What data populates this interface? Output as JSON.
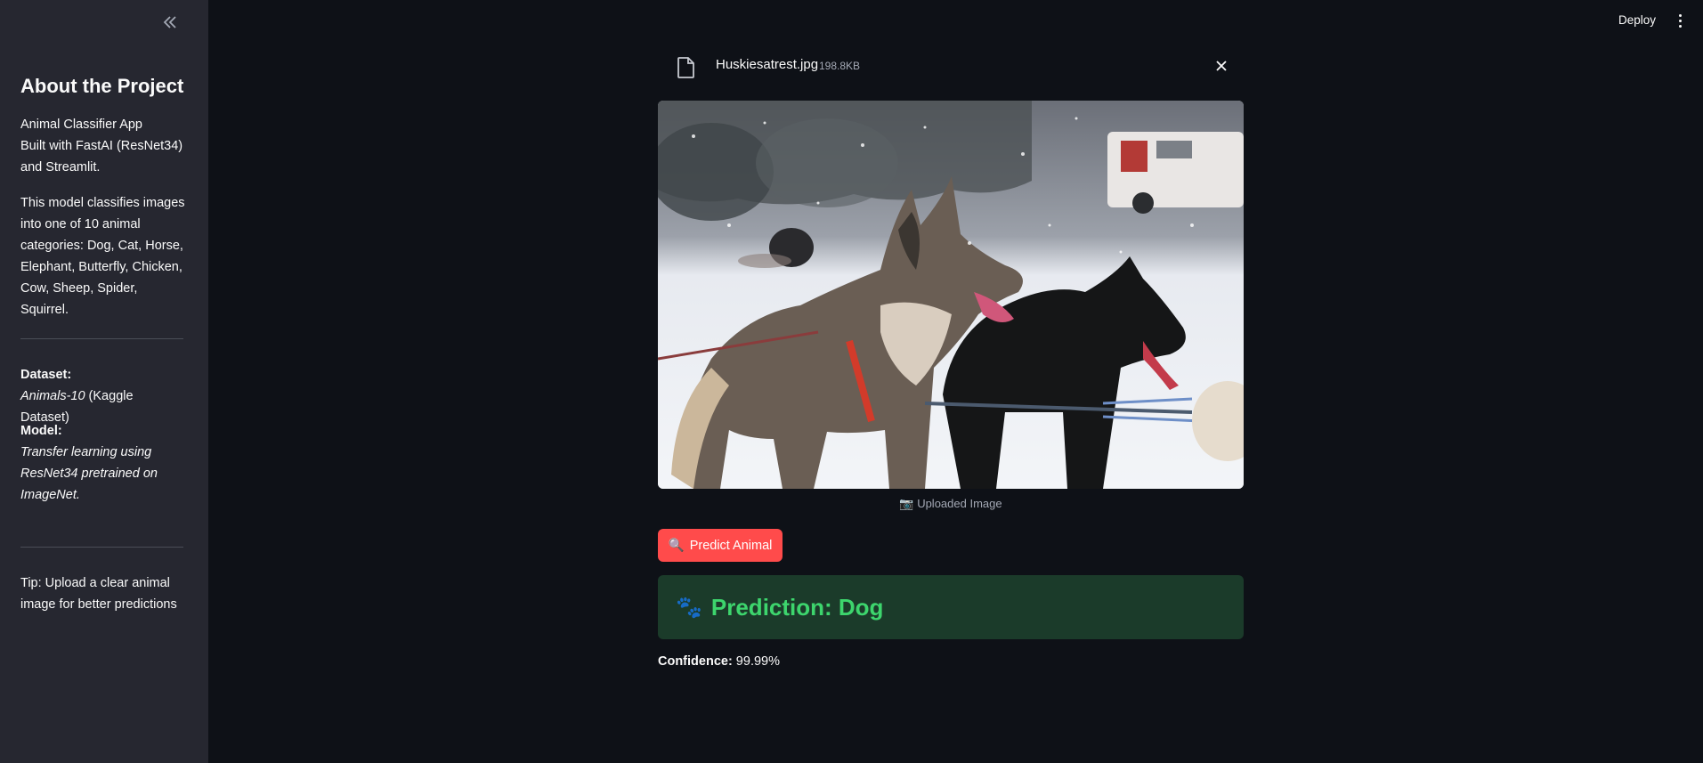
{
  "sidebar": {
    "collapse_icon": "double-chevron-left-icon",
    "title": "About the Project",
    "intro_line1": "Animal Classifier App",
    "intro_line2": "Built with FastAI (ResNet34)",
    "intro_line3": "and Streamlit.",
    "description": "This model classifies images into one of 10 animal categories: Dog, Cat, Horse, Elephant, Butterfly, Chicken, Cow, Sheep, Spider, Squirrel.",
    "dataset_label": "Dataset:",
    "dataset_name": "Animals-10",
    "dataset_source": " (Kaggle Dataset)",
    "model_label": "Model:",
    "model_desc": "Transfer learning using ResNet34 pretrained on ImageNet.",
    "tip": "Tip: Upload a clear animal image for better predictions"
  },
  "header": {
    "deploy_label": "Deploy",
    "menu_icon": "kebab-menu-icon"
  },
  "file": {
    "name": "Huskiesatrest.jpg",
    "size": "198.8KB",
    "icon": "file-icon",
    "close_icon": "close-icon"
  },
  "image": {
    "caption": "📷 Uploaded Image"
  },
  "predict": {
    "button_label": "Predict Animal",
    "button_icon": "🔍"
  },
  "result": {
    "icon": "🐾",
    "prediction": "Prediction: Dog",
    "confidence_label": "Confidence:",
    "confidence_value": " 99.99%"
  },
  "colors": {
    "background": "#0e1117",
    "sidebar": "#262730",
    "accent_button": "#ff4b4b",
    "success_bg": "#1b3b2a",
    "success_text": "#3dd56d"
  }
}
